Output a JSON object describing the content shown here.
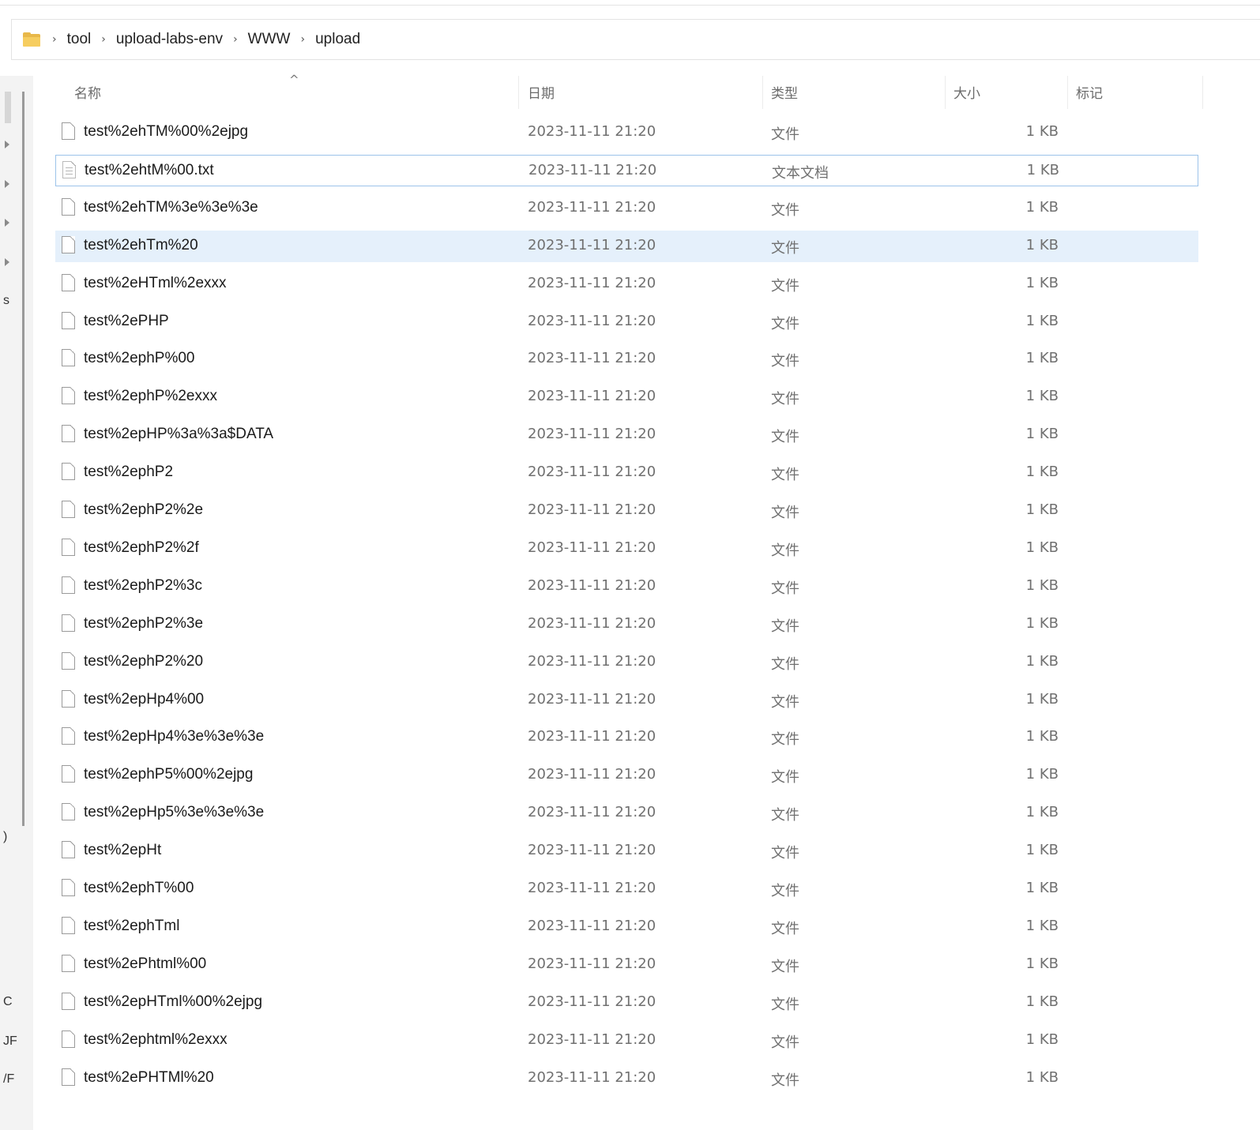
{
  "breadcrumb": {
    "items": [
      "tool",
      "upload-labs-env",
      "WWW",
      "upload"
    ],
    "separator": "›"
  },
  "nav_pane": {
    "fragments": [
      "s",
      ")",
      "C",
      "JF",
      "/F"
    ]
  },
  "columns": {
    "name": "名称",
    "date": "日期",
    "type": "类型",
    "size": "大小",
    "tags": "标记",
    "sort_indicator": "^"
  },
  "files": [
    {
      "name": "test%2ehTM%00%2ejpg",
      "date": "2023-11-11 21:20",
      "type": "文件",
      "size": "1 KB"
    },
    {
      "name": "test%2ehtM%00.txt",
      "date": "2023-11-11 21:20",
      "type": "文本文档",
      "size": "1 KB",
      "icon": "text-file-icon",
      "state": "focused"
    },
    {
      "name": "test%2ehTM%3e%3e%3e",
      "date": "2023-11-11 21:20",
      "type": "文件",
      "size": "1 KB"
    },
    {
      "name": "test%2ehTm%20",
      "date": "2023-11-11 21:20",
      "type": "文件",
      "size": "1 KB",
      "state": "selected"
    },
    {
      "name": "test%2eHTml%2exxx",
      "date": "2023-11-11 21:20",
      "type": "文件",
      "size": "1 KB"
    },
    {
      "name": "test%2ePHP",
      "date": "2023-11-11 21:20",
      "type": "文件",
      "size": "1 KB"
    },
    {
      "name": "test%2ephP%00",
      "date": "2023-11-11 21:20",
      "type": "文件",
      "size": "1 KB"
    },
    {
      "name": "test%2ephP%2exxx",
      "date": "2023-11-11 21:20",
      "type": "文件",
      "size": "1 KB"
    },
    {
      "name": "test%2epHP%3a%3a$DATA",
      "date": "2023-11-11 21:20",
      "type": "文件",
      "size": "1 KB"
    },
    {
      "name": "test%2ephP2",
      "date": "2023-11-11 21:20",
      "type": "文件",
      "size": "1 KB"
    },
    {
      "name": "test%2ephP2%2e",
      "date": "2023-11-11 21:20",
      "type": "文件",
      "size": "1 KB"
    },
    {
      "name": "test%2ephP2%2f",
      "date": "2023-11-11 21:20",
      "type": "文件",
      "size": "1 KB"
    },
    {
      "name": "test%2ephP2%3c",
      "date": "2023-11-11 21:20",
      "type": "文件",
      "size": "1 KB"
    },
    {
      "name": "test%2ephP2%3e",
      "date": "2023-11-11 21:20",
      "type": "文件",
      "size": "1 KB"
    },
    {
      "name": "test%2ephP2%20",
      "date": "2023-11-11 21:20",
      "type": "文件",
      "size": "1 KB"
    },
    {
      "name": "test%2epHp4%00",
      "date": "2023-11-11 21:20",
      "type": "文件",
      "size": "1 KB"
    },
    {
      "name": "test%2epHp4%3e%3e%3e",
      "date": "2023-11-11 21:20",
      "type": "文件",
      "size": "1 KB"
    },
    {
      "name": "test%2ephP5%00%2ejpg",
      "date": "2023-11-11 21:20",
      "type": "文件",
      "size": "1 KB"
    },
    {
      "name": "test%2epHp5%3e%3e%3e",
      "date": "2023-11-11 21:20",
      "type": "文件",
      "size": "1 KB"
    },
    {
      "name": "test%2epHt",
      "date": "2023-11-11 21:20",
      "type": "文件",
      "size": "1 KB"
    },
    {
      "name": "test%2ephT%00",
      "date": "2023-11-11 21:20",
      "type": "文件",
      "size": "1 KB"
    },
    {
      "name": "test%2ephTml",
      "date": "2023-11-11 21:20",
      "type": "文件",
      "size": "1 KB"
    },
    {
      "name": "test%2ePhtml%00",
      "date": "2023-11-11 21:20",
      "type": "文件",
      "size": "1 KB"
    },
    {
      "name": "test%2epHTml%00%2ejpg",
      "date": "2023-11-11 21:20",
      "type": "文件",
      "size": "1 KB"
    },
    {
      "name": "test%2ephtml%2exxx",
      "date": "2023-11-11 21:20",
      "type": "文件",
      "size": "1 KB"
    },
    {
      "name": "test%2ePHTMl%20",
      "date": "2023-11-11 21:20",
      "type": "文件",
      "size": "1 KB"
    }
  ],
  "colors": {
    "selected_row": "#e5f0fb",
    "focus_border": "#9cc3ea",
    "folder": "#f6cd5f"
  }
}
